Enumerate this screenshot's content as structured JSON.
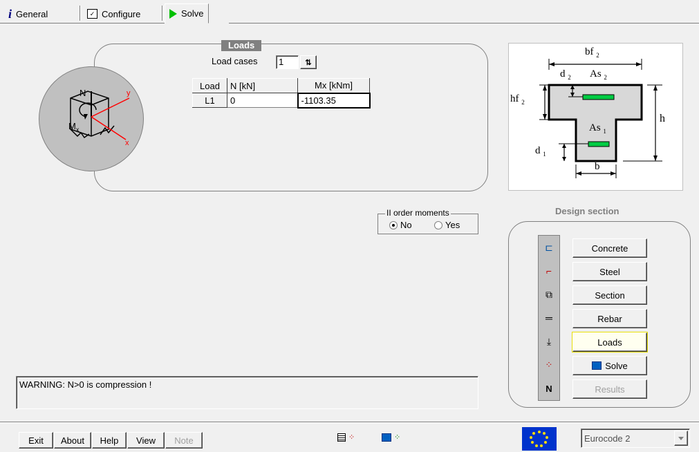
{
  "tabs": [
    {
      "label": "General",
      "icon": "info-icon"
    },
    {
      "label": "Configure",
      "icon": "checklist-icon"
    },
    {
      "label": "Solve",
      "icon": "play-icon"
    }
  ],
  "loads": {
    "title": "Loads",
    "load_cases_label": "Load cases",
    "load_cases_value": "1",
    "columns": [
      "Load",
      "N  [kN]",
      "Mx [kNm]"
    ],
    "rows": [
      {
        "load": "L1",
        "n": "0",
        "mx": "-1103.35"
      }
    ]
  },
  "diagram": {
    "labels": {
      "N": "N",
      "Mx": "M",
      "x_sub": "x",
      "y": "y",
      "x": "x"
    }
  },
  "section_diagram": {
    "bf": "bf",
    "bf_sub": "2",
    "d2": "d",
    "d2_sub": "2",
    "As2": "As",
    "As2_sub": "2",
    "hf": "hf",
    "hf_sub": "2",
    "h": "h",
    "As1": "As",
    "As1_sub": "1",
    "d1": "d",
    "d1_sub": "1",
    "b": "b"
  },
  "second_order": {
    "title": "II order moments",
    "options": [
      "No",
      "Yes"
    ],
    "selected": "No"
  },
  "design_section": {
    "title": "Design section",
    "buttons": [
      "Concrete",
      "Steel",
      "Section",
      "Rebar",
      "Loads",
      "Solve",
      "Results"
    ],
    "tool_icons": [
      "concrete-diagram-icon",
      "steel-diagram-icon",
      "section-shapes-icon",
      "rebar-icon",
      "loads-icon",
      "solve-dots-icon",
      "n-icon"
    ],
    "tool_n_label": "N"
  },
  "warning": "WARNING:  N>0 is compression !",
  "bottom": {
    "buttons": [
      "Exit",
      "About",
      "Help",
      "View",
      "Note"
    ],
    "code_select": "Eurocode 2"
  },
  "colors": {
    "accent_green": "#00cc44",
    "red": "#ff0000",
    "panel_bg": "#f0f0f0"
  }
}
